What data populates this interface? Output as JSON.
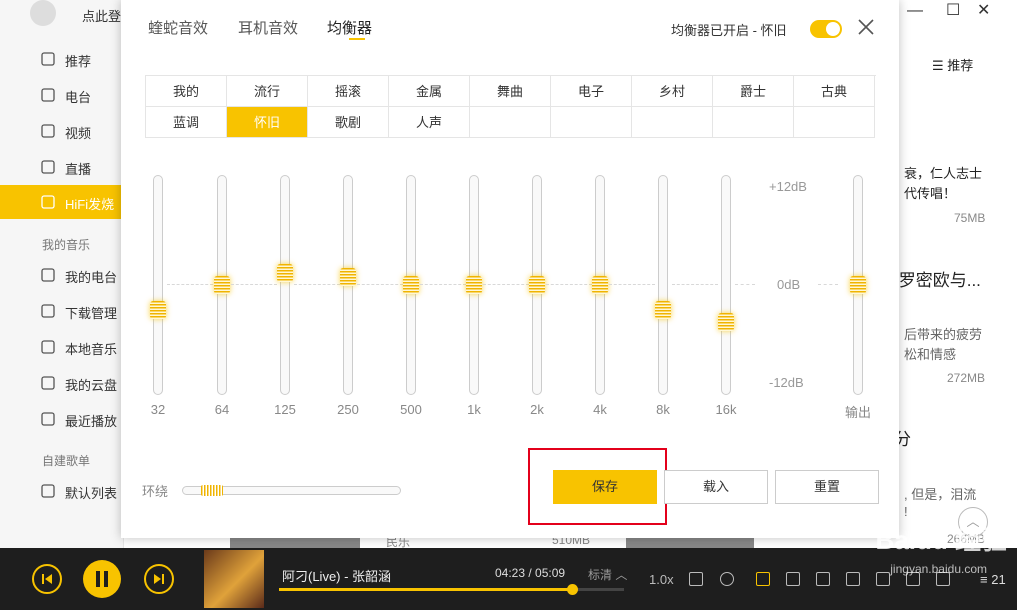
{
  "app": {
    "login_text": "点此登",
    "nav": [
      {
        "icon": "star-icon",
        "label": "推荐"
      },
      {
        "icon": "radio-icon",
        "label": "电台"
      },
      {
        "icon": "video-icon",
        "label": "视频"
      },
      {
        "icon": "live-icon",
        "label": "直播"
      },
      {
        "icon": "hifi-icon",
        "label": "HiFi发烧"
      }
    ],
    "my_music_title": "我的音乐",
    "my_music": [
      {
        "icon": "podcast-icon",
        "label": "我的电台"
      },
      {
        "icon": "download-icon",
        "label": "下载管理"
      },
      {
        "icon": "monitor-icon",
        "label": "本地音乐"
      },
      {
        "icon": "cloud-icon",
        "label": "我的云盘"
      },
      {
        "icon": "clock-icon",
        "label": "最近播放"
      }
    ],
    "playlists_title": "自建歌单",
    "playlists": [
      {
        "icon": "list-icon",
        "label": "默认列表"
      }
    ],
    "right_rec": "推荐",
    "right_snippets": [
      {
        "text": "衰，仁人志士",
        "sub": "代传唱！",
        "size": "75MB"
      },
      {
        "text": ":罗密欧与...",
        "sub": "后带来的疲劳",
        "sub2": "松和情感",
        "size": "272MB"
      },
      {
        "text": "分",
        "sub": ", 但是，泪流",
        "sub2": "!",
        "size": "266MB"
      }
    ],
    "bottom_label": "民乐",
    "bottom_size": "510MB"
  },
  "player": {
    "song": "阿刁(Live) - 张韶涵",
    "time": "04:23 / 05:09",
    "progress": 0.85,
    "quality": "标清",
    "speed": "1.0x",
    "queue_count": "21"
  },
  "eq": {
    "tabs": [
      "蝰蛇音效",
      "耳机音效",
      "均衡器"
    ],
    "active_tab": 2,
    "status": "均衡器已开启 - 怀旧",
    "enabled": true,
    "presets_row1": [
      "我的",
      "流行",
      "摇滚",
      "金属",
      "舞曲",
      "电子",
      "乡村",
      "爵士",
      "古典"
    ],
    "presets_row2": [
      "蓝调",
      "怀旧",
      "歌剧",
      "人声",
      "",
      "",
      "",
      "",
      ""
    ],
    "selected_preset": "怀旧",
    "db_labels": [
      "+12dB",
      "0dB",
      "-12dB"
    ],
    "bands": [
      {
        "freq": "32",
        "gain": -3
      },
      {
        "freq": "64",
        "gain": 0
      },
      {
        "freq": "125",
        "gain": 1.5
      },
      {
        "freq": "250",
        "gain": 1
      },
      {
        "freq": "500",
        "gain": 0
      },
      {
        "freq": "1k",
        "gain": 0
      },
      {
        "freq": "2k",
        "gain": 0
      },
      {
        "freq": "4k",
        "gain": 0
      },
      {
        "freq": "8k",
        "gain": -3
      },
      {
        "freq": "16k",
        "gain": -4.5
      }
    ],
    "output": {
      "label": "输出",
      "gain": 0
    },
    "surround_label": "环绕",
    "surround_level": 0.08,
    "save_label": "保存",
    "load_label": "载入",
    "reset_label": "重置"
  },
  "watermark": {
    "brand": "Baidu 经验",
    "url": "jingyan.baidu.com"
  }
}
